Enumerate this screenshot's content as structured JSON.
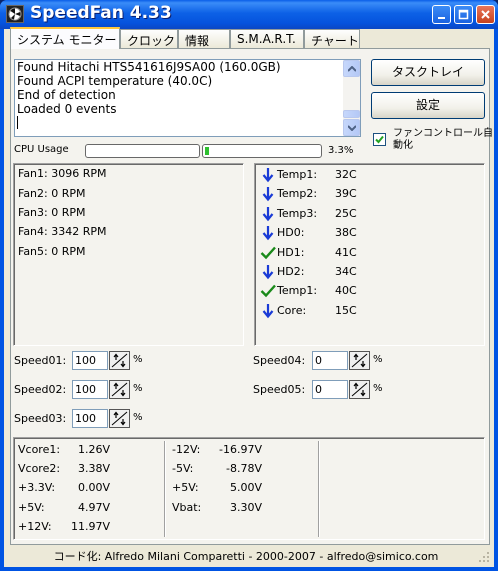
{
  "window": {
    "title": "SpeedFan 4.33"
  },
  "tabs": [
    {
      "label": "システム モニター",
      "active": true
    },
    {
      "label": "クロック",
      "active": false
    },
    {
      "label": "情報",
      "active": false
    },
    {
      "label": "S.M.A.R.T.",
      "active": false
    },
    {
      "label": "チャート",
      "active": false
    }
  ],
  "log": {
    "lines": [
      "Found Hitachi HTS541616J9SA00 (160.0GB)",
      "Found ACPI temperature (40.0C)",
      "End of detection",
      "Loaded 0 events"
    ]
  },
  "buttons": {
    "minimize_to_tray": "タスクトレイ",
    "settings": "設定"
  },
  "auto_fan": {
    "label": "ファンコントロール自動化",
    "checked": true
  },
  "cpu": {
    "label": "CPU Usage",
    "value": "3.3%",
    "usage_fraction": 0.033
  },
  "fans": [
    "Fan1: 3096 RPM",
    "Fan2: 0 RPM",
    "Fan3: 0 RPM",
    "Fan4: 3342 RPM",
    "Fan5: 0 RPM"
  ],
  "temps": [
    {
      "name": "Temp1:",
      "value": "32C",
      "icon": "arrow-down-icon"
    },
    {
      "name": "Temp2:",
      "value": "39C",
      "icon": "arrow-down-icon"
    },
    {
      "name": "Temp3:",
      "value": "25C",
      "icon": "arrow-down-icon"
    },
    {
      "name": "HD0:",
      "value": "38C",
      "icon": "arrow-down-icon"
    },
    {
      "name": "HD1:",
      "value": "41C",
      "icon": "check-icon"
    },
    {
      "name": "HD2:",
      "value": "34C",
      "icon": "arrow-down-icon"
    },
    {
      "name": "Temp1:",
      "value": "40C",
      "icon": "check-icon"
    },
    {
      "name": "Core:",
      "value": "15C",
      "icon": "arrow-down-icon"
    }
  ],
  "speeds": [
    {
      "label": "Speed01:",
      "value": "100",
      "unit": "%"
    },
    {
      "label": "Speed02:",
      "value": "100",
      "unit": "%"
    },
    {
      "label": "Speed03:",
      "value": "100",
      "unit": "%"
    },
    {
      "label": "Speed04:",
      "value": "0",
      "unit": "%"
    },
    {
      "label": "Speed05:",
      "value": "0",
      "unit": "%"
    }
  ],
  "voltages_col1": [
    {
      "name": "Vcore1:",
      "value": "1.26V"
    },
    {
      "name": "Vcore2:",
      "value": "3.38V"
    },
    {
      "name": "+3.3V:",
      "value": "0.00V"
    },
    {
      "name": "+5V:",
      "value": "4.97V"
    },
    {
      "name": "+12V:",
      "value": "11.97V"
    }
  ],
  "voltages_col2": [
    {
      "name": "-12V:",
      "value": "-16.97V"
    },
    {
      "name": "-5V:",
      "value": "-8.78V"
    },
    {
      "name": "+5V:",
      "value": "5.00V"
    },
    {
      "name": "Vbat:",
      "value": "3.30V"
    }
  ],
  "status": "コード化: Alfredo Milani Comparetti - 2000-2007 - alfredo@simico.com",
  "colors": {
    "title_blue": "#0054e3",
    "down_arrow": "#1a3bd6",
    "check_green": "#1a8a1a",
    "meter_green": "#2fc02f"
  }
}
